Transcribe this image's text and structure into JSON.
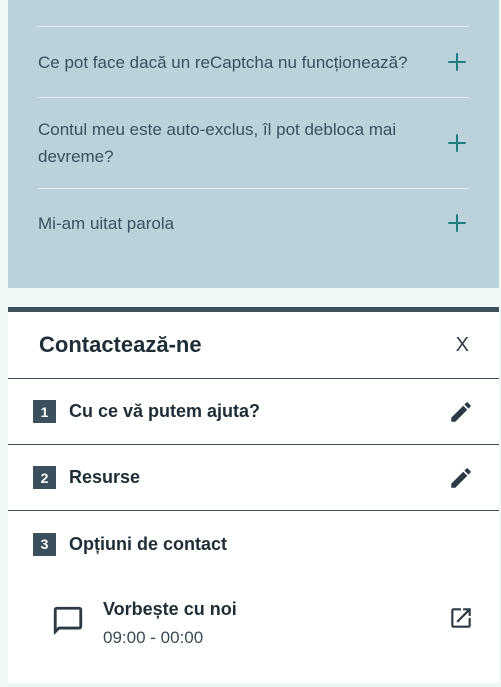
{
  "faq": {
    "items": [
      {
        "question": "Ce pot face dacă un reCaptcha nu funcționează?"
      },
      {
        "question": "Contul meu este auto-exclus, îl pot debloca mai devreme?"
      },
      {
        "question": "Mi-am uitat parola"
      }
    ]
  },
  "contact_panel": {
    "title": "Contactează-ne",
    "close_label": "X",
    "steps": [
      {
        "number": "1",
        "label": "Cu ce vă putem ajuta?",
        "icon": "pencil-icon"
      },
      {
        "number": "2",
        "label": "Resurse",
        "icon": "pencil-icon"
      },
      {
        "number": "3",
        "label": "Opțiuni de contact"
      }
    ],
    "option": {
      "title": "Vorbește cu noi",
      "hours": "09:00 - 00:00",
      "icon": "chat-bubble-icon",
      "action_icon": "external-link-icon"
    }
  },
  "colors": {
    "faq_background": "#bcd2da",
    "accent": "#1f7d80",
    "dark": "#3c4f5d",
    "page_background": "#eef8f6"
  }
}
